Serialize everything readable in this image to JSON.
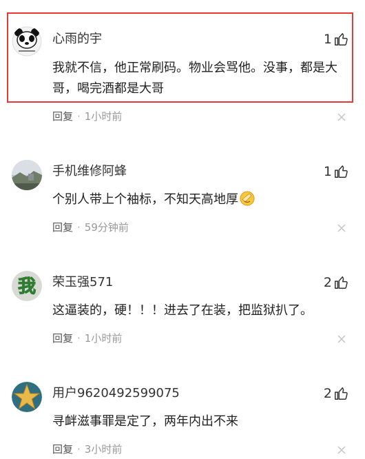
{
  "comments": [
    {
      "username": "心雨的宇",
      "likes": "1",
      "text": "我就不信，他正常刷码。物业会骂他。没事，都是大哥，喝完酒都是大哥",
      "reply_label": "回复",
      "time": "1小时前",
      "avatar_icon": "panda-meme-avatar",
      "highlighted": true
    },
    {
      "username": "手机维修阿蜂",
      "likes": "1",
      "text": "个别人带上个袖标，不知天高地厚",
      "reply_label": "回复",
      "time": "59分钟前",
      "avatar_icon": "landscape-photo-avatar"
    },
    {
      "username": "荣玉强571",
      "likes": "2",
      "text": "这逼装的，硬！！！进去了在装，把监狱扒了。",
      "reply_label": "回复",
      "time": "1小时前",
      "avatar_icon": "red-character-avatar",
      "avatar_text": "我"
    },
    {
      "username": "用户9620492599075",
      "likes": "2",
      "text": "寻衅滋事罪是定了，两年内出不来",
      "reply_label": "回复",
      "time": "3小时前",
      "avatar_icon": "gold-star-avatar"
    }
  ],
  "colors": {
    "highlight": "#e53935",
    "text": "#222222",
    "meta": "#999999"
  }
}
